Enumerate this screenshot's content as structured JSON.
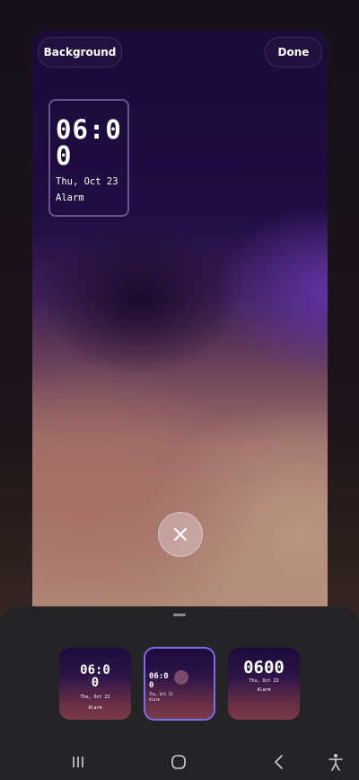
{
  "toolbar": {
    "background_label": "Background",
    "done_label": "Done"
  },
  "clock": {
    "time": "06:00",
    "date": "Thu, Oct 23",
    "alarm": "Alarm"
  },
  "thumbnails": [
    {
      "time": "06:00",
      "date": "Thu, Oct 23",
      "alarm": "Alarm",
      "selected": false
    },
    {
      "time": "06:00",
      "date": "Thu, Oct 23",
      "alarm": "Alarm",
      "selected": true
    },
    {
      "time": "0600",
      "date": "Thu, Oct 23",
      "alarm": "Alarm",
      "selected": false
    }
  ],
  "icons": {
    "close": "close-icon",
    "recents": "recents-icon",
    "home": "home-icon",
    "back": "back-icon",
    "accessibility": "accessibility-icon"
  },
  "colors": {
    "accent": "#7b6ce8",
    "sheet": "#242326"
  }
}
